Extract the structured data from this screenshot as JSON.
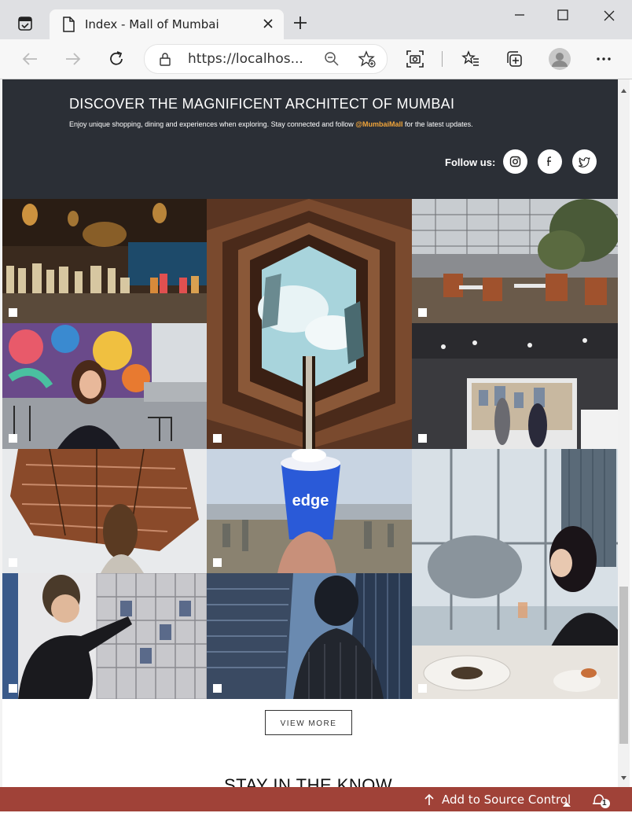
{
  "browser": {
    "tab_title": "Index - Mall of Mumbai",
    "url": "https://localhos..."
  },
  "hero": {
    "title": "DISCOVER THE MAGNIFICENT ARCHITECT OF MUMBAI",
    "subtitle_pre": "Enjoy unique shopping, dining and experiences when exploring. Stay connected and follow ",
    "handle": "@MumbaiMall",
    "subtitle_post": " for the latest updates.",
    "follow_label": "Follow us:",
    "social": [
      "instagram-icon",
      "facebook-icon",
      "twitter-icon"
    ],
    "bg_color": "#2b2f36",
    "accent_color": "#f0a43a"
  },
  "gallery": {
    "tiles": [
      "cocktails-bar",
      "vessel-sky-view",
      "restaurant-interior",
      "woman-mural",
      "store-display",
      "woman-vessel",
      "edge-cup-skyline",
      "woman-glass-window",
      "man-store-shelves",
      "statue-buildings"
    ]
  },
  "view_more_label": "VIEW MORE",
  "next_section_title": "STAY IN THE KNOW",
  "status_bar": {
    "label": "Add to Source Control",
    "notification_count": "1",
    "bg_color": "#a04238"
  }
}
